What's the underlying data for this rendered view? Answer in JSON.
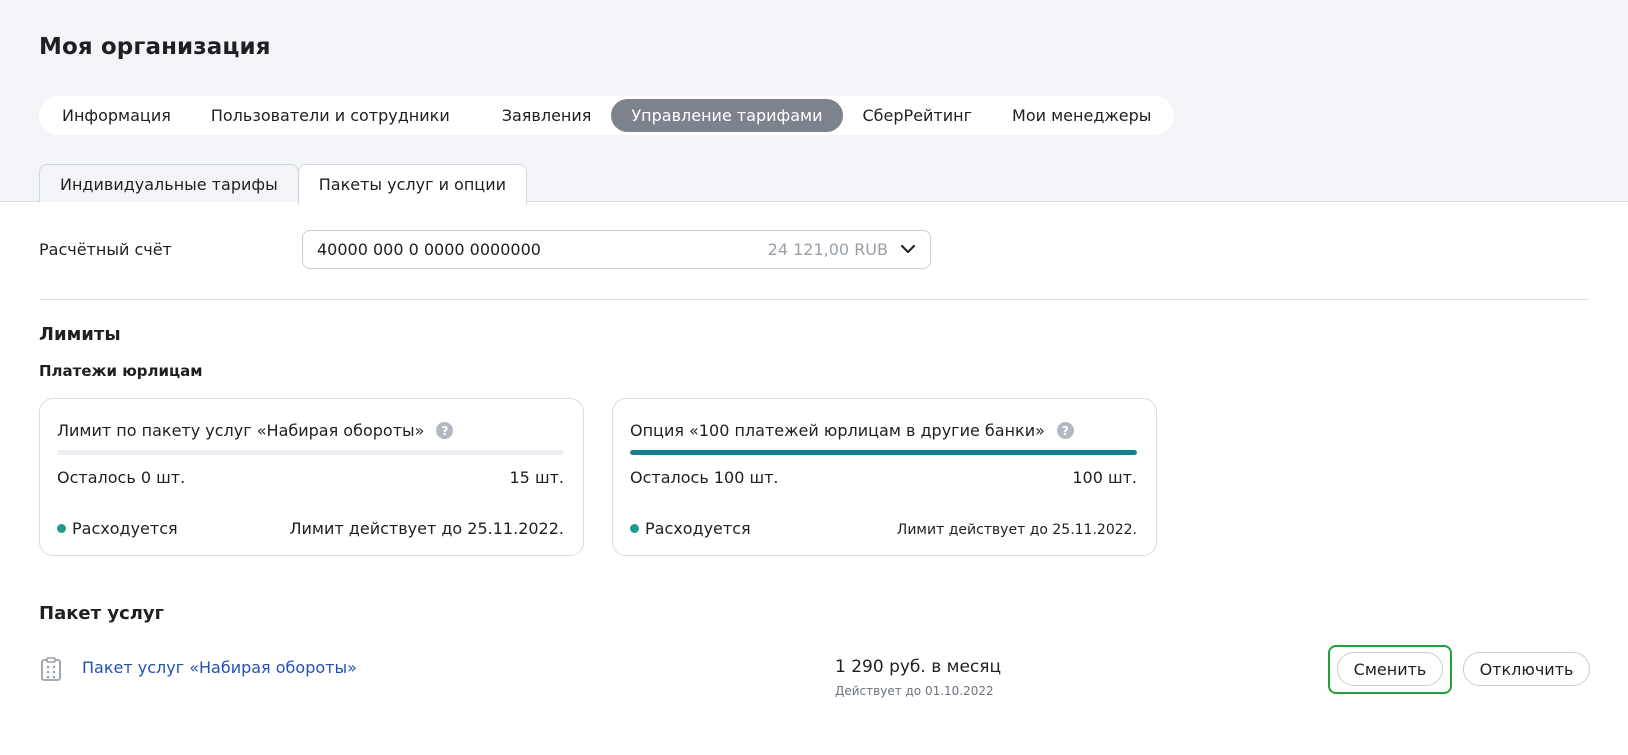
{
  "page": {
    "title": "Моя организация"
  },
  "nav": {
    "items": [
      {
        "label": "Информация",
        "active": false
      },
      {
        "label": "Пользователи и сотрудники",
        "active": false
      },
      {
        "label": "Заявления",
        "active": false
      },
      {
        "label": "Управление тарифами",
        "active": true
      },
      {
        "label": "СберРейтинг",
        "active": false
      },
      {
        "label": "Мои менеджеры",
        "active": false
      }
    ]
  },
  "subtabs": {
    "items": [
      {
        "label": "Индивидуальные тарифы",
        "active": false
      },
      {
        "label": "Пакеты услуг и опции",
        "active": true
      }
    ]
  },
  "account": {
    "label": "Расчётный счёт",
    "number": "40000 000 0 0000 0000000",
    "balance": "24 121,00 RUB"
  },
  "limits": {
    "heading": "Лимиты",
    "subheading": "Платежи юрлицам",
    "cards": [
      {
        "title": "Лимит по пакету услуг «Набирая обороты»",
        "progress": 0,
        "remaining": "Осталось 0 шт.",
        "total": "15 шт.",
        "status": "Расходуется",
        "valid_until": "Лимит действует до 25.11.2022."
      },
      {
        "title": "Опция «100 платежей юрлицам в другие банки»",
        "progress": 1,
        "remaining": "Осталось 100 шт.",
        "total": "100 шт.",
        "status": "Расходуется",
        "valid_until": "Лимит действует до 25.11.2022."
      }
    ]
  },
  "package": {
    "heading": "Пакет услуг",
    "name": "Пакет услуг «Набирая обороты»",
    "price": "1 290 руб. в месяц",
    "valid_until": "Действует до 01.10.2022",
    "change_label": "Сменить",
    "disable_label": "Отключить"
  },
  "colors": {
    "accent": "#137f8a",
    "status_dot": "#1d9c8b",
    "link": "#2151b4",
    "focus": "#21a038",
    "active_tab": "#7d838c"
  },
  "icons": {
    "help": "help-icon",
    "chevron": "chevron-down-icon",
    "package": "package-icon"
  }
}
